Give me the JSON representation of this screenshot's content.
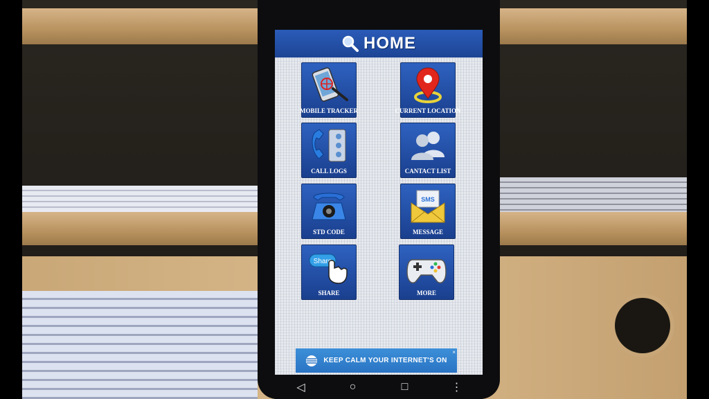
{
  "app": {
    "title": "HOME",
    "title_icon": "magnifier-icon"
  },
  "tiles": [
    {
      "label": "MOBILE TRACKER",
      "icon": "tracker-phone-icon"
    },
    {
      "label": "CURRENT LOCATION",
      "icon": "map-pin-icon"
    },
    {
      "label": "CALL LOGS",
      "icon": "call-log-icon"
    },
    {
      "label": "CANTACT LIST",
      "icon": "contacts-icon"
    },
    {
      "label": "STD CODE",
      "icon": "rotary-phone-icon"
    },
    {
      "label": "MESSAGE",
      "icon": "sms-envelope-icon"
    },
    {
      "label": "SHARE",
      "icon": "share-hand-icon"
    },
    {
      "label": "MORE",
      "icon": "gamepad-icon"
    }
  ],
  "ad": {
    "text": "KEEP CALM YOUR INTERNET'S ON",
    "close": "×"
  },
  "nav": {
    "back": "◁",
    "home": "○",
    "recents": "□",
    "menu": "⋮"
  },
  "colors": {
    "header_blue": "#1e4595",
    "tile_blue": "#2e62c0",
    "ad_blue": "#2a74c4"
  }
}
